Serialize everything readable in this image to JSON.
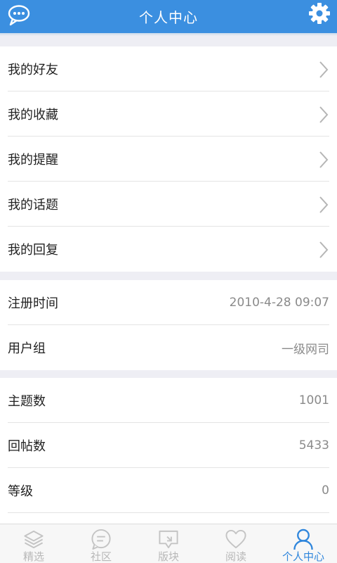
{
  "header": {
    "title": "个人中心",
    "left_icon": "chat-bubble-icon",
    "right_icon": "gear-icon"
  },
  "menu": {
    "items": [
      {
        "label": "我的好友"
      },
      {
        "label": "我的收藏"
      },
      {
        "label": "我的提醒"
      },
      {
        "label": "我的话题"
      },
      {
        "label": "我的回复"
      }
    ]
  },
  "account": {
    "rows": [
      {
        "label": "注册时间",
        "value": "2010-4-28 09:07"
      },
      {
        "label": "用户组",
        "value": "一级网司"
      }
    ]
  },
  "stats": {
    "rows": [
      {
        "label": "主题数",
        "value": "1001"
      },
      {
        "label": "回帖数",
        "value": "5433"
      },
      {
        "label": "等级",
        "value": "0"
      }
    ]
  },
  "tabbar": {
    "tabs": [
      {
        "label": "精选",
        "icon": "layers-icon"
      },
      {
        "label": "社区",
        "icon": "comment-icon"
      },
      {
        "label": "版块",
        "icon": "board-icon"
      },
      {
        "label": "阅读",
        "icon": "heart-icon"
      },
      {
        "label": "个人中心",
        "icon": "person-icon"
      }
    ],
    "active_index": 4
  },
  "colors": {
    "accent": "#3b8fe0",
    "active_tab": "#2f86dc",
    "inactive_tab": "#b8b8b8"
  }
}
